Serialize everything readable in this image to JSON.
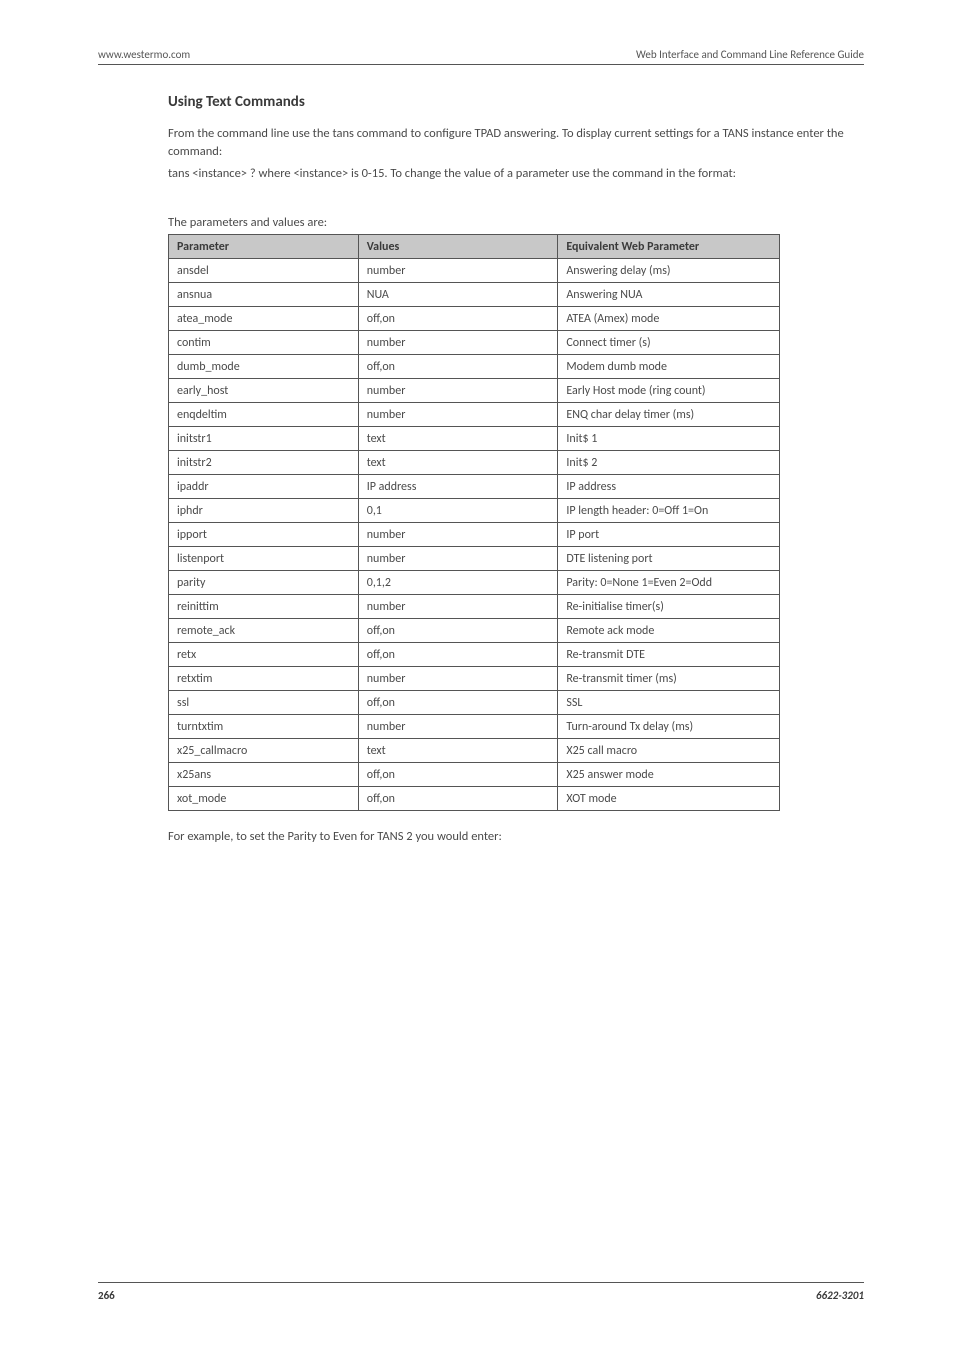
{
  "header": {
    "left": "www.westermo.com",
    "right": "Web Interface and Command Line Reference Guide"
  },
  "section_title": "Using Text Commands",
  "intro_para": "From the command line use the tans command to configure TPAD answering. To display current settings for a TANS instance enter the command:",
  "intro_cmd": "tans <instance> ? where <instance> is 0-15. To change the value of a parameter use the command in the format:",
  "table_caption": "The parameters and values are:",
  "table": {
    "headers": [
      "Parameter",
      "Values",
      "Equivalent Web Parameter"
    ],
    "rows": [
      [
        "ansdel",
        "number",
        "Answering delay (ms)"
      ],
      [
        "ansnua",
        "NUA",
        "Answering NUA"
      ],
      [
        "atea_mode",
        "off,on",
        "ATEA (Amex) mode"
      ],
      [
        "contim",
        "number",
        "Connect timer (s)"
      ],
      [
        "dumb_mode",
        "off,on",
        "Modem dumb mode"
      ],
      [
        "early_host",
        "number",
        "Early Host mode (ring count)"
      ],
      [
        "enqdeltim",
        "number",
        "ENQ char delay timer (ms)"
      ],
      [
        "initstr1",
        "text",
        "Init$ 1"
      ],
      [
        "initstr2",
        "text",
        "Init$ 2"
      ],
      [
        "ipaddr",
        "IP address",
        "IP address"
      ],
      [
        "iphdr",
        "0,1",
        "IP length header: 0=Off 1=On"
      ],
      [
        "ipport",
        "number",
        "IP port"
      ],
      [
        "listenport",
        "number",
        "DTE listening port"
      ],
      [
        "parity",
        "0,1,2",
        "Parity: 0=None 1=Even 2=Odd"
      ],
      [
        "reinittim",
        "number",
        "Re-initialise timer(s)"
      ],
      [
        "remote_ack",
        "off,on",
        "Remote ack mode"
      ],
      [
        "retx",
        "off,on",
        "Re-transmit DTE"
      ],
      [
        "retxtim",
        "number",
        "Re-transmit timer (ms)"
      ],
      [
        "ssl",
        "off,on",
        "SSL"
      ],
      [
        "turntxtim",
        "number",
        "Turn-around Tx delay (ms)"
      ],
      [
        "x25_callmacro",
        "text",
        "X25 call macro"
      ],
      [
        "x25ans",
        "off,on",
        "X25 answer mode"
      ],
      [
        "xot_mode",
        "off,on",
        "XOT mode"
      ]
    ]
  },
  "post_table": "For example, to set the Parity to Even for TANS 2 you would enter:",
  "footer": {
    "page": "266",
    "docid": "6622-3201"
  }
}
